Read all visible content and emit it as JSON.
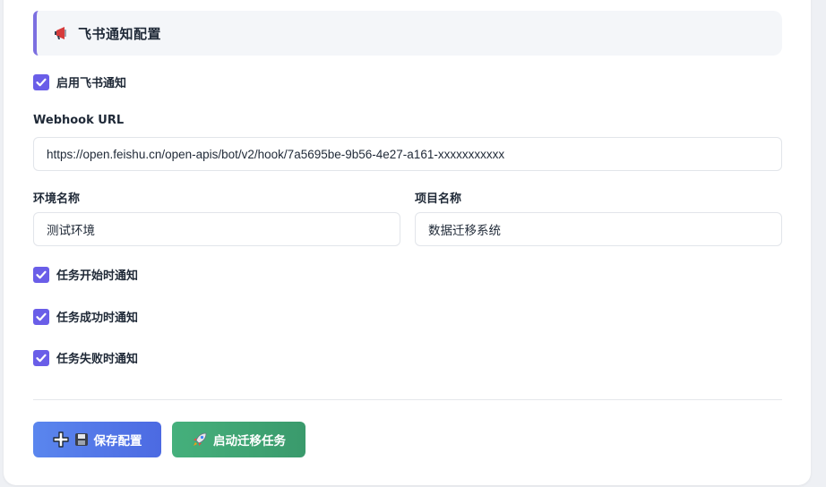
{
  "section": {
    "title": "飞书通知配置",
    "icon": "megaphone-icon"
  },
  "enable_notify": {
    "label": "启用飞书通知",
    "checked": true
  },
  "webhook": {
    "label": "Webhook URL",
    "value": "https://open.feishu.cn/open-apis/bot/v2/hook/7a5695be-9b56-4e27-a161-xxxxxxxxxxx"
  },
  "environment": {
    "label": "环境名称",
    "value": "测试环境"
  },
  "project": {
    "label": "项目名称",
    "value": "数据迁移系统"
  },
  "notify_options": [
    {
      "label": "任务开始时通知",
      "checked": true
    },
    {
      "label": "任务成功时通知",
      "checked": true
    },
    {
      "label": "任务失败时通知",
      "checked": true
    }
  ],
  "actions": {
    "save_label": "保存配置",
    "start_label": "启动迁移任务"
  },
  "colors": {
    "accent": "#6a5ee8",
    "save_button": "#4f6fe6",
    "start_button": "#3fa573"
  }
}
